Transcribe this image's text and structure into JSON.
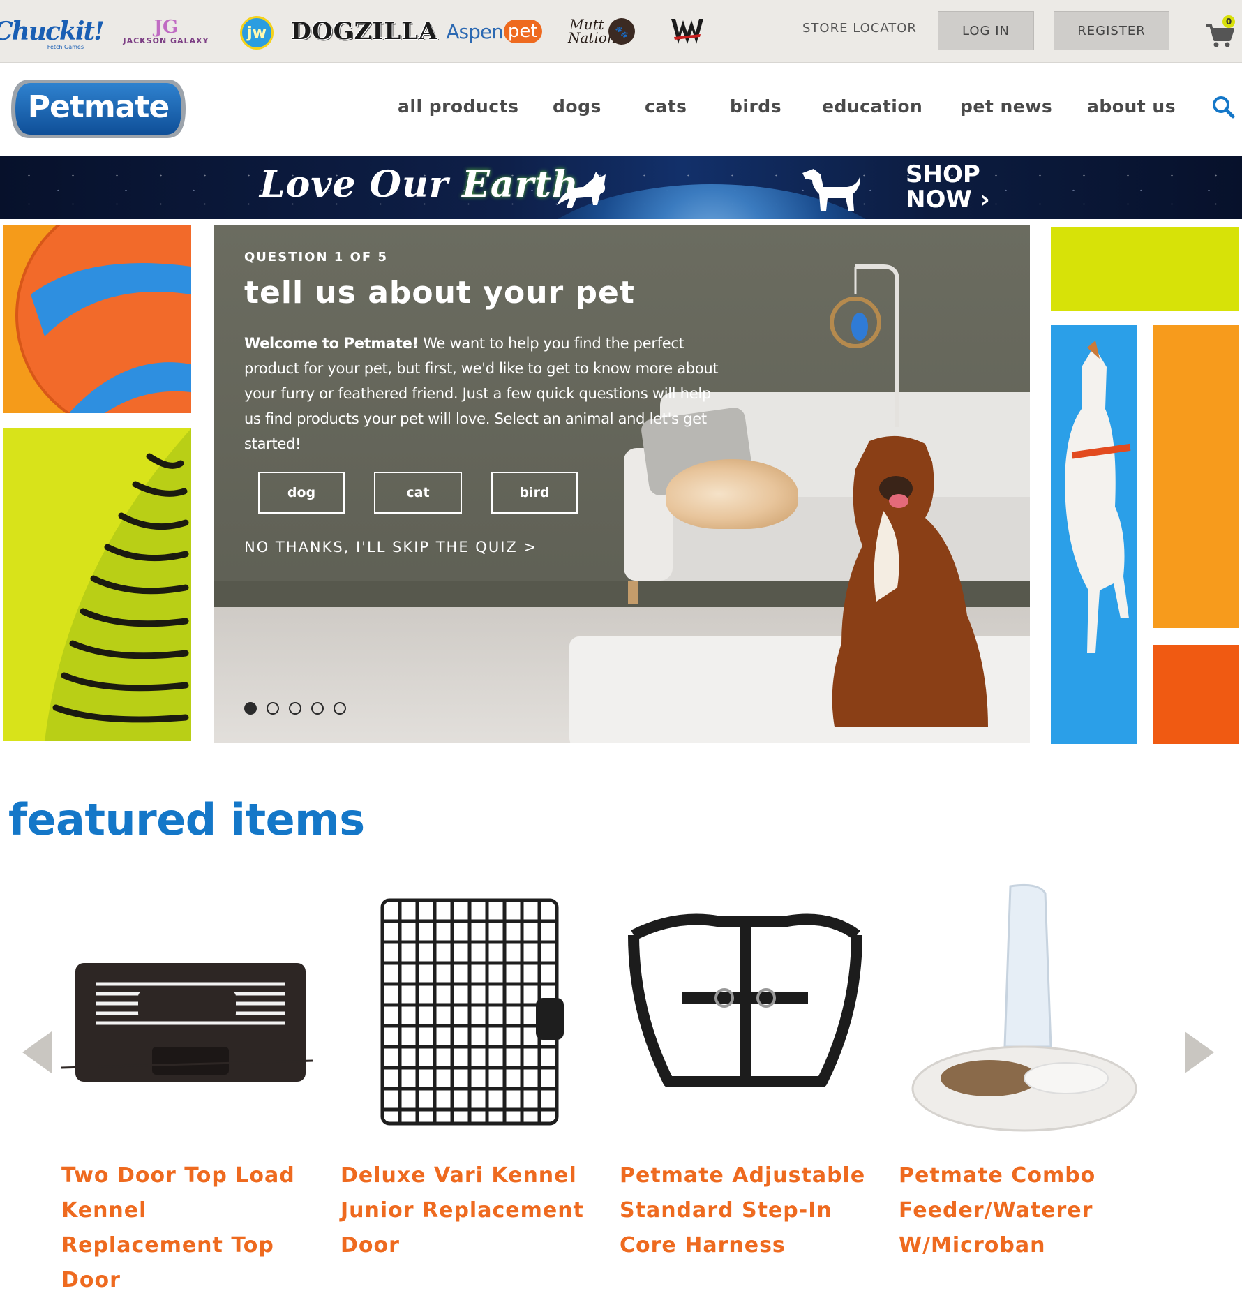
{
  "brands": {
    "chuckit": "Chuckit!",
    "chuckit_sub": "Fetch Games",
    "jackson_mark": "JG",
    "jackson": "JACKSON GALAXY",
    "jw": "jw",
    "dogzilla": "DOGZILLA",
    "aspen_a": "Aspen",
    "aspen_b": "pet",
    "mutt": "Mutt Nation",
    "w": "W"
  },
  "topbar": {
    "store_locator": "STORE LOCATOR",
    "login": "LOG IN",
    "register": "REGISTER",
    "cart_count": "0"
  },
  "header": {
    "logo": "Petmate",
    "nav": [
      "all products",
      "dogs",
      "cats",
      "birds",
      "education",
      "pet news",
      "about us"
    ]
  },
  "promo": {
    "title_a": "Love Our",
    "title_b": "Earth",
    "cta_line1": "SHOP",
    "cta_line2": "NOW ›"
  },
  "hero": {
    "question": "QUESTION 1 OF 5",
    "title": "tell us about your pet",
    "body_bold": "Welcome to Petmate!",
    "body": " We want to help you find the perfect product for your pet, but first, we'd like to get to know more about your furry or feathered friend. Just a few quick questions will help us find products your pet will love. Select an animal and let's get started!",
    "options": [
      "dog",
      "cat",
      "bird"
    ],
    "skip": "NO THANKS, I'LL SKIP THE QUIZ >",
    "slides_total": 5,
    "slide_active": 1
  },
  "featured": {
    "title": "featured items",
    "products": [
      {
        "name": "Two Door Top Load Kennel Replacement Top Door"
      },
      {
        "name": "Deluxe Vari Kennel Junior Replacement Door"
      },
      {
        "name": "Petmate Adjustable Standard Step-In Core Harness"
      },
      {
        "name": "Petmate Combo Feeder/Waterer W/Microban"
      }
    ]
  },
  "colors": {
    "accent_blue": "#1477c8",
    "accent_orange": "#ee6a1f",
    "topbar_bg": "#eceae6",
    "nav_text": "#4a4a4a"
  },
  "icons": [
    "shopping-cart-icon",
    "search-icon",
    "chevron-left-icon",
    "chevron-right-icon"
  ]
}
